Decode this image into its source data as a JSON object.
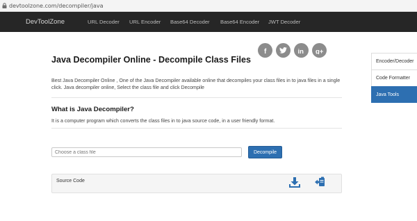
{
  "browser": {
    "url": "devtoolzone.com/decompiler/java"
  },
  "nav": {
    "brand": "DevToolZone",
    "links": [
      "URL Decoder",
      "URL Encoder",
      "Base64 Decoder",
      "Base64 Encoder",
      "JWT Decoder"
    ]
  },
  "social": [
    "facebook-icon",
    "twitter-icon",
    "linkedin-icon",
    "google-plus-icon"
  ],
  "main": {
    "title": "Java Decompiler Online - Decompile Class Files",
    "description": "Best Java Decompiler Online , One of the Java Decompiler available online that decompiles your class files in to java files in a single click. Java decompiler online, Select the class file and click Decompile",
    "subtitle": "What is Java Decompiler?",
    "subtitle_desc": "It is a computer program which converts the class files in to java source code, in a user friendly format.",
    "file_placeholder": "Choose a class file",
    "decompile_label": "Decompile",
    "source_label": "Source Code"
  },
  "sidebar": {
    "items": [
      {
        "label": "Encoder/Decoder",
        "active": false
      },
      {
        "label": "Code Formatter",
        "active": false
      },
      {
        "label": "Java Tools",
        "active": true
      }
    ]
  },
  "colors": {
    "nav_bg": "#262626",
    "accent": "#2d6fb1",
    "social_bg": "#8c8c8c"
  }
}
